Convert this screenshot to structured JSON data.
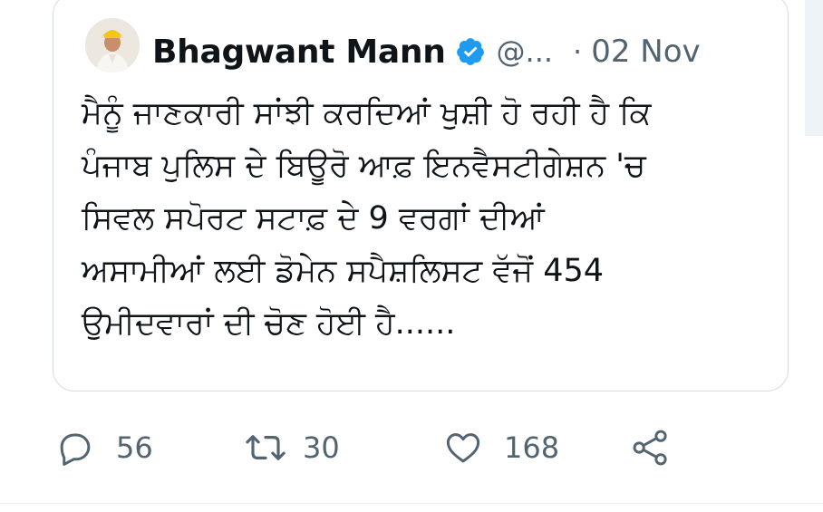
{
  "tweet": {
    "author_name": "Bhagwant Mann",
    "handle": "@...",
    "separator": "·",
    "date": "02 Nov",
    "text_lines": [
      "ਮੈਨੂੰ ਜਾਣਕਾਰੀ ਸਾਂਝੀ ਕਰਦਿਆਂ ਖੁਸ਼ੀ ਹੋ ਰਹੀ ਹੈ ਕਿ",
      "ਪੰਜਾਬ ਪੁਲਿਸ ਦੇ ਬਿਊਰੋ ਆਫ਼ ਇਨਵੈਸਟੀਗੇਸ਼ਨ 'ਚ",
      "ਸਿਵਲ ਸਪੋਰਟ ਸਟਾਫ਼ ਦੇ 9 ਵਰਗਾਂ ਦੀਆਂ",
      "ਅਸਾਮੀਆਂ ਲਈ ਡੋਮੇਨ ਸਪੈਸ਼ਲਿਸਟ ਵੱਜੋਂ 454",
      "ਉਮੀਦਵਾਰਾਂ ਦੀ ਚੋਣ ਹੋਈ ਹੈ......"
    ]
  },
  "actions": {
    "replies": "56",
    "retweets": "30",
    "likes": "168"
  },
  "icons": {
    "reply": "reply-icon",
    "retweet": "retweet-icon",
    "like": "heart-icon",
    "share": "share-icon",
    "verified": "verified-badge-icon"
  },
  "colors": {
    "verified_blue": "#1d9bf0",
    "muted_text": "#536471",
    "card_border": "#d6dde2"
  }
}
